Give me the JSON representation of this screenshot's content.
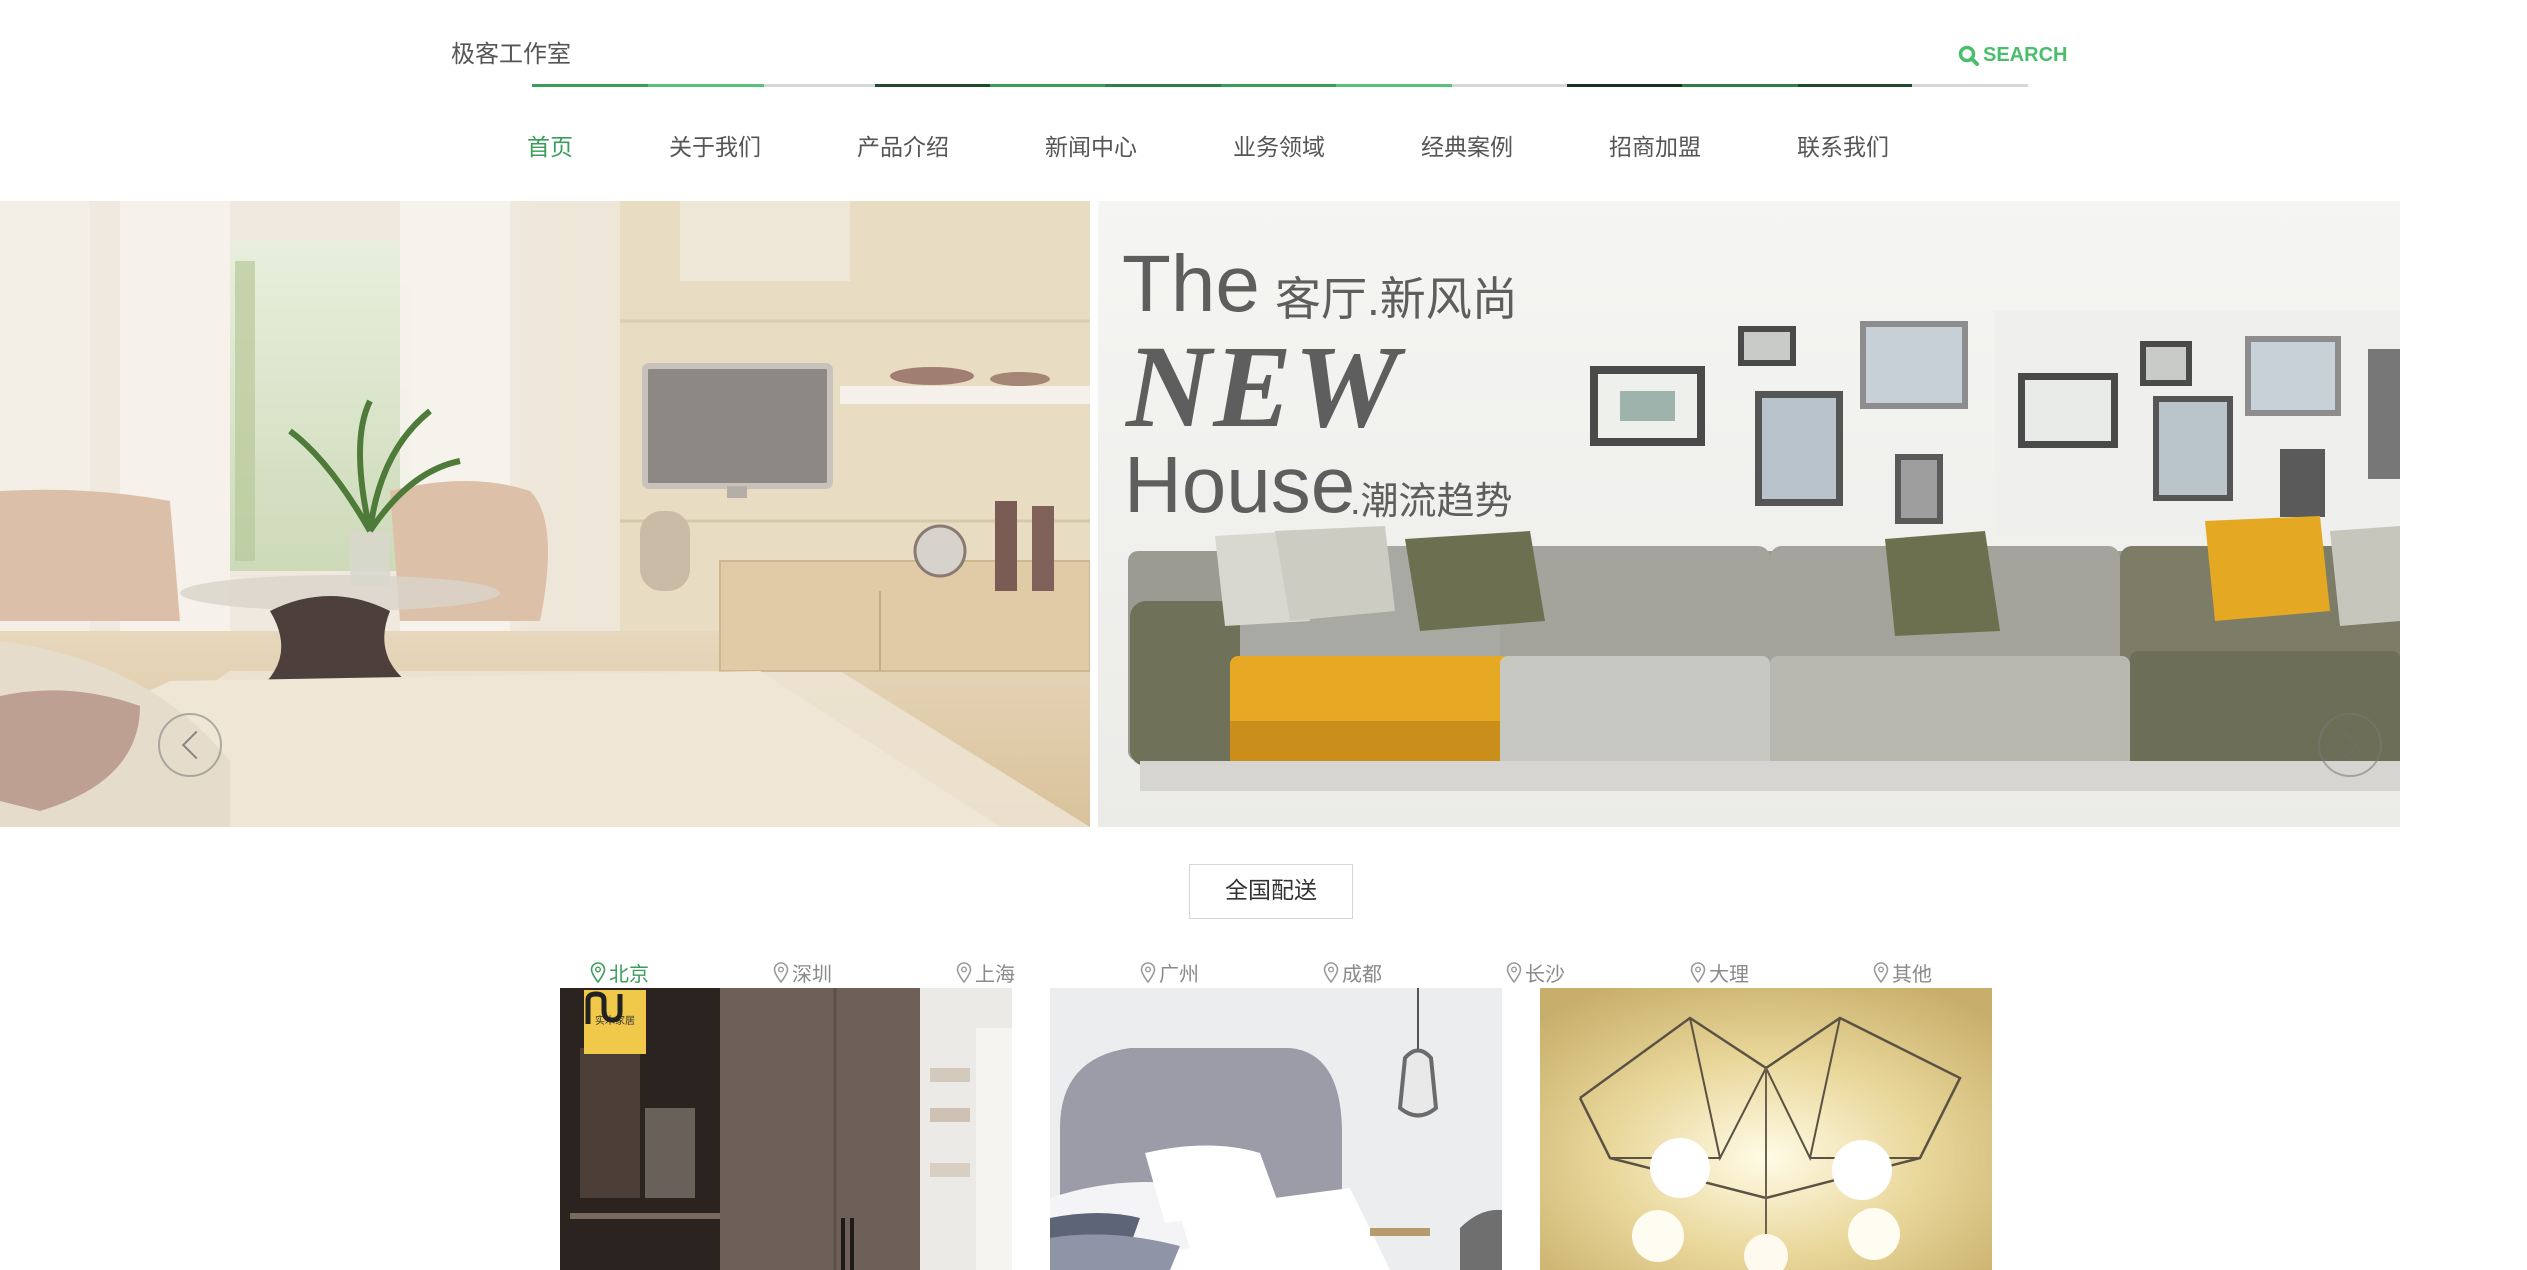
{
  "header": {
    "logo_text": "极客工作室",
    "search_label": "SEARCH",
    "accent_color": "#4cbd6d"
  },
  "nav": {
    "items": [
      {
        "label": "首页",
        "active": true
      },
      {
        "label": "关于我们"
      },
      {
        "label": "产品介绍"
      },
      {
        "label": "新闻中心"
      },
      {
        "label": "业务领域"
      },
      {
        "label": "经典案例"
      },
      {
        "label": "招商加盟"
      },
      {
        "label": "联系我们"
      }
    ]
  },
  "banner": {
    "line1_big": "The",
    "line1_small": "客厅.新风尚",
    "line2": "NEW",
    "line3_big": "House",
    "line3_small": ".潮流趋势",
    "slide_count": 3,
    "active_slide": 1
  },
  "delivery": {
    "label": "全国配送"
  },
  "cities": {
    "items": [
      {
        "label": "北京",
        "active": true
      },
      {
        "label": "深圳"
      },
      {
        "label": "上海"
      },
      {
        "label": "广州"
      },
      {
        "label": "成都"
      },
      {
        "label": "长沙"
      },
      {
        "label": "大理"
      },
      {
        "label": "其他"
      }
    ]
  },
  "cards": {
    "items": [
      {
        "subject": "wardrobe",
        "badge_text": "实木家居"
      },
      {
        "subject": "bedroom"
      },
      {
        "subject": "ceiling-lamp"
      }
    ]
  },
  "icons": {
    "search": "search-icon",
    "arrow_prev": "chevron-left-icon",
    "arrow_next": "chevron-right-icon",
    "location": "map-pin-icon"
  }
}
